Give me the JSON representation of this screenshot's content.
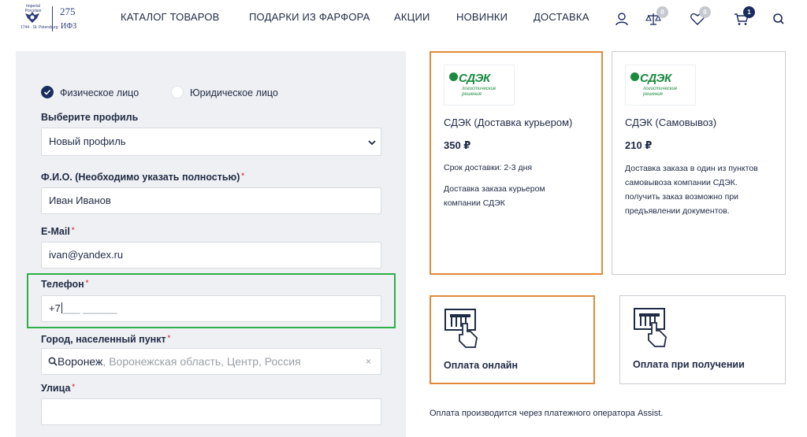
{
  "header": {
    "logo": {
      "number": "275",
      "abbr": "ИФЗ",
      "arc_text": "Imperial Porcelain",
      "sub_text": "1744 · St. Petersburg"
    },
    "nav": [
      "КАТАЛОГ ТОВАРОВ",
      "ПОДАРКИ ИЗ ФАРФОРА",
      "АКЦИИ",
      "НОВИНКИ",
      "ДОСТАВКА"
    ],
    "icons": [
      "user-icon",
      "scales-icon",
      "heart-icon",
      "cart-icon",
      "search-icon"
    ],
    "compare_count": "0",
    "favorites_count": "0",
    "cart_count": "1"
  },
  "form": {
    "person_types": [
      {
        "label": "Физическое лицо",
        "selected": true
      },
      {
        "label": "Юридическое лицо",
        "selected": false
      }
    ],
    "profile": {
      "label": "Выберите профиль",
      "value": "Новый профиль"
    },
    "fio": {
      "label": "Ф.И.О. (Необходимо указать полностью)",
      "required": "*",
      "value": "Иван Иванов"
    },
    "email": {
      "label": "E-Mail",
      "required": "*",
      "value": "ivan@yandex.ru"
    },
    "phone": {
      "label": "Телефон",
      "required": "*",
      "prefix": "+7",
      "mask": "___ ______"
    },
    "city": {
      "label": "Город, населенный пункт",
      "required": "*",
      "value": "Воронеж",
      "hint": ", Воронежская область, Центр, Россия",
      "clear": "×"
    },
    "street": {
      "label": "Улица",
      "required": "*",
      "value": ""
    }
  },
  "delivery": [
    {
      "logo": "СДЭК",
      "logo_tag": "логистические решения",
      "title": "СДЭК (Доставка курьером)",
      "price": "350 ₽",
      "term": "Срок доставки: 2-3 дня",
      "description": "Доставка заказа курьером компании СДЭК",
      "selected": true
    },
    {
      "logo": "СДЭК",
      "logo_tag": "логистические решения",
      "title": "СДЭК (Самовывоз)",
      "price": "210 ₽",
      "description": "Доставка заказа в один из пунктов самовывоза компании СДЭК.\n получить заказ возможно при предъявлении документов.",
      "selected": false
    }
  ],
  "payment": [
    {
      "title": "Оплата онлайн",
      "icon": "atm-icon",
      "selected": true
    },
    {
      "title": "Оплата при получении",
      "icon": "atm-icon",
      "selected": false
    }
  ],
  "payment_note": "Оплата производится через платежного оператора Assist.",
  "colors": {
    "accent": "#1a2b5e",
    "selected_border": "#e28a3a",
    "highlight": "#2fae4a",
    "brand_green": "#1a8a3e",
    "required": "#e0404a"
  }
}
